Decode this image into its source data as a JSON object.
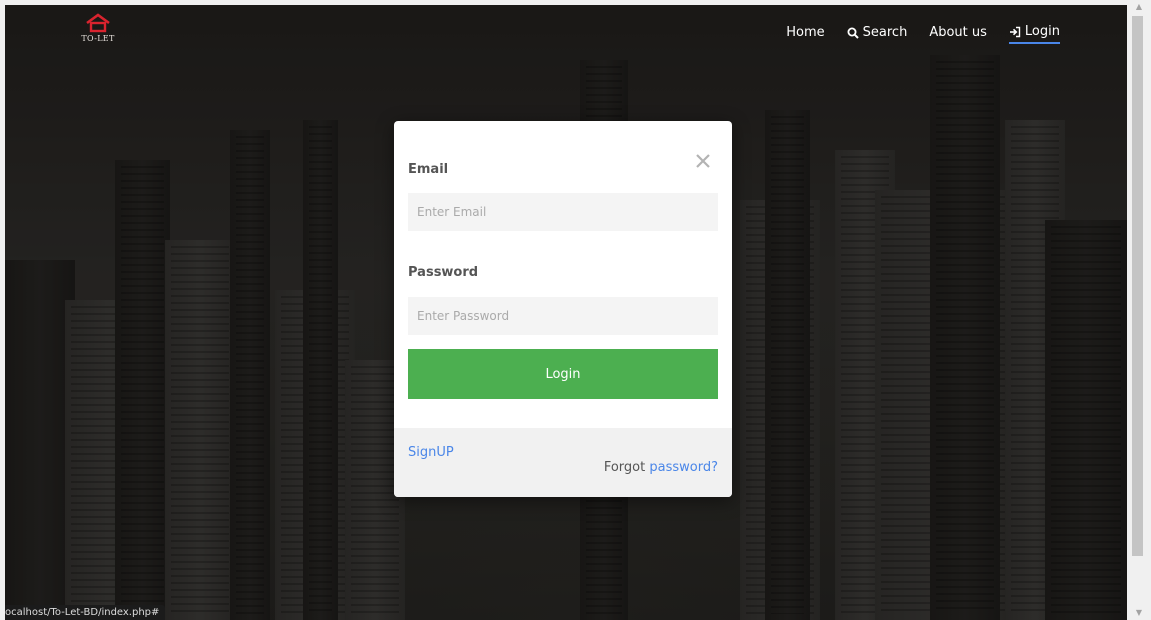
{
  "brand": {
    "logo_text": "TO-LET"
  },
  "nav": {
    "items": [
      {
        "label": "Home",
        "icon": ""
      },
      {
        "label": "Search",
        "icon": "search-icon"
      },
      {
        "label": "About us",
        "icon": ""
      },
      {
        "label": "Login",
        "icon": "sign-in-icon",
        "active": true
      }
    ]
  },
  "modal": {
    "email_label": "Email",
    "email_placeholder": "Enter Email",
    "password_label": "Password",
    "password_placeholder": "Enter Password",
    "login_button": "Login",
    "close_icon": "close-icon",
    "signup_link": "SignUP",
    "forgot_prefix": "Forgot",
    "forgot_link": "password?"
  },
  "status_bar": {
    "url": "ocalhost/To-Let-BD/index.php#"
  },
  "colors": {
    "accent": "#4a86e8",
    "button": "#4caf50",
    "logo": "#d9232e"
  }
}
